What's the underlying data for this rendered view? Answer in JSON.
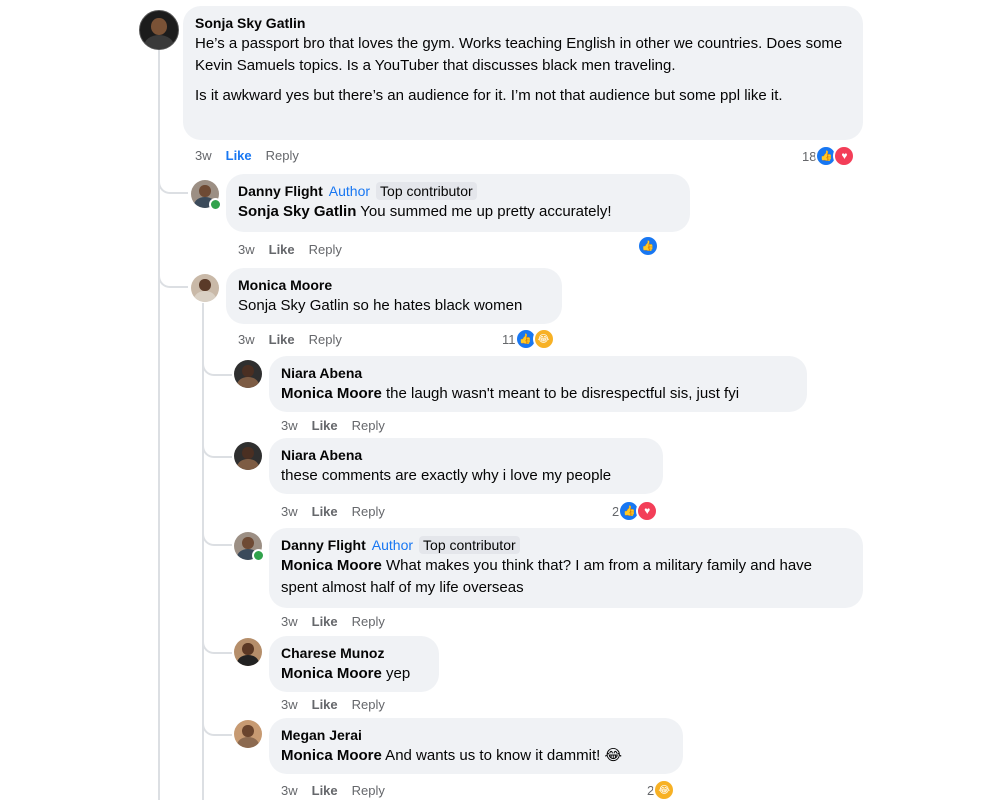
{
  "comments": [
    {
      "author": "Sonja Sky Gatlin",
      "paragraphs": [
        "He’s a passport bro that loves the gym. Works teaching English in other we countries. Does some Kevin Samuels topics. Is a YouTuber that discusses black men traveling.",
        "Is it awkward yes but there’s an audience for it. I’m not that audience but some ppl like it."
      ],
      "time": "3w",
      "like": "Like",
      "reply": "Reply",
      "reaction_count": "18",
      "reactions": [
        "like-icon",
        "heart-icon"
      ]
    },
    {
      "author": "Danny Flight",
      "author_tag": "Author",
      "badge": "Top contributor",
      "mention": "Sonja Sky Gatlin",
      "text": " You summed me up pretty accurately!",
      "time": "3w",
      "like": "Like",
      "reply": "Reply",
      "reaction_count": "",
      "reactions": [
        "like-icon"
      ]
    },
    {
      "author": "Monica Moore",
      "text": "Sonja Sky Gatlin so he hates black women",
      "time": "3w",
      "like": "Like",
      "reply": "Reply",
      "reaction_count": "11",
      "reactions": [
        "like-icon",
        "haha-icon"
      ]
    },
    {
      "author": "Niara Abena",
      "mention": "Monica Moore",
      "text": " the laugh wasn't meant to be disrespectful sis, just fyi",
      "time": "3w",
      "like": "Like",
      "reply": "Reply"
    },
    {
      "author": "Niara Abena",
      "text": "these comments are exactly why i love my people",
      "time": "3w",
      "like": "Like",
      "reply": "Reply",
      "reaction_count": "2",
      "reactions": [
        "like-icon",
        "heart-icon"
      ]
    },
    {
      "author": "Danny Flight",
      "author_tag": "Author",
      "badge": "Top contributor",
      "mention": "Monica Moore",
      "text": " What makes you think that? I am from a military family and have spent almost half of my life overseas",
      "time": "3w",
      "like": "Like",
      "reply": "Reply"
    },
    {
      "author": "Charese Munoz",
      "mention": "Monica Moore",
      "text": " yep",
      "time": "3w",
      "like": "Like",
      "reply": "Reply"
    },
    {
      "author": "Megan Jerai",
      "mention": "Monica Moore",
      "text": " And wants us to know it dammit! 😂",
      "time": "3w",
      "like": "Like",
      "reply": "Reply",
      "reaction_count": "2",
      "reactions": [
        "haha-icon"
      ]
    }
  ],
  "colors": {
    "bubble": "#f0f2f5",
    "like_blue": "#1877f2",
    "heart_red": "#f33e58",
    "haha_yellow": "#f7b125",
    "meta_gray": "#65676b",
    "online_green": "#31a24c"
  }
}
